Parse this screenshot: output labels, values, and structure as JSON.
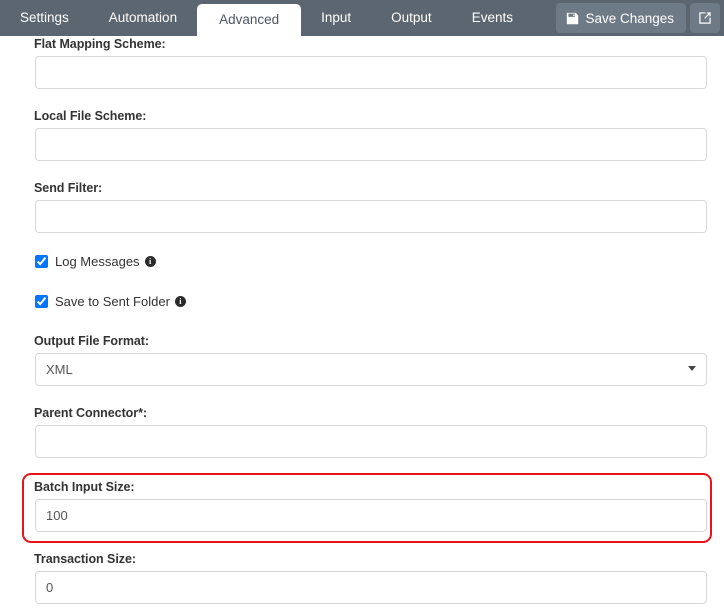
{
  "tabs": [
    {
      "label": "Settings",
      "active": false
    },
    {
      "label": "Automation",
      "active": false
    },
    {
      "label": "Advanced",
      "active": true
    },
    {
      "label": "Input",
      "active": false
    },
    {
      "label": "Output",
      "active": false
    },
    {
      "label": "Events",
      "active": false
    }
  ],
  "toolbar": {
    "save_label": "Save Changes",
    "save_icon": "floppy-disk-icon",
    "external_link_icon": "external-link-icon"
  },
  "colors": {
    "tabbar_background": "#5b6670",
    "button_background": "#6e7a85",
    "active_tab_background": "#ffffff",
    "highlight_border": "#e8131b",
    "input_border": "#d8d8d8",
    "label_text": "#333333"
  },
  "form": {
    "flat_mapping_scheme": {
      "label": "Flat Mapping Scheme:",
      "value": "",
      "placeholder": ""
    },
    "local_file_scheme": {
      "label": "Local File Scheme:",
      "value": "",
      "placeholder": ""
    },
    "send_filter": {
      "label": "Send Filter:",
      "value": "",
      "placeholder": ""
    },
    "log_messages": {
      "label": "Log Messages",
      "checked": true,
      "info_icon": "info-icon",
      "info_glyph": "i"
    },
    "save_to_sent_folder": {
      "label": "Save to Sent Folder",
      "checked": true,
      "info_icon": "info-icon",
      "info_glyph": "i"
    },
    "output_file_format": {
      "label": "Output File Format:",
      "value": "XML",
      "options": [
        "XML"
      ]
    },
    "parent_connector": {
      "label": "Parent Connector*:",
      "value": "",
      "placeholder": ""
    },
    "batch_input_size": {
      "label": "Batch Input Size:",
      "value": "100",
      "placeholder": "",
      "highlighted": true
    },
    "transaction_size": {
      "label": "Transaction Size:",
      "value": "0",
      "placeholder": ""
    }
  }
}
